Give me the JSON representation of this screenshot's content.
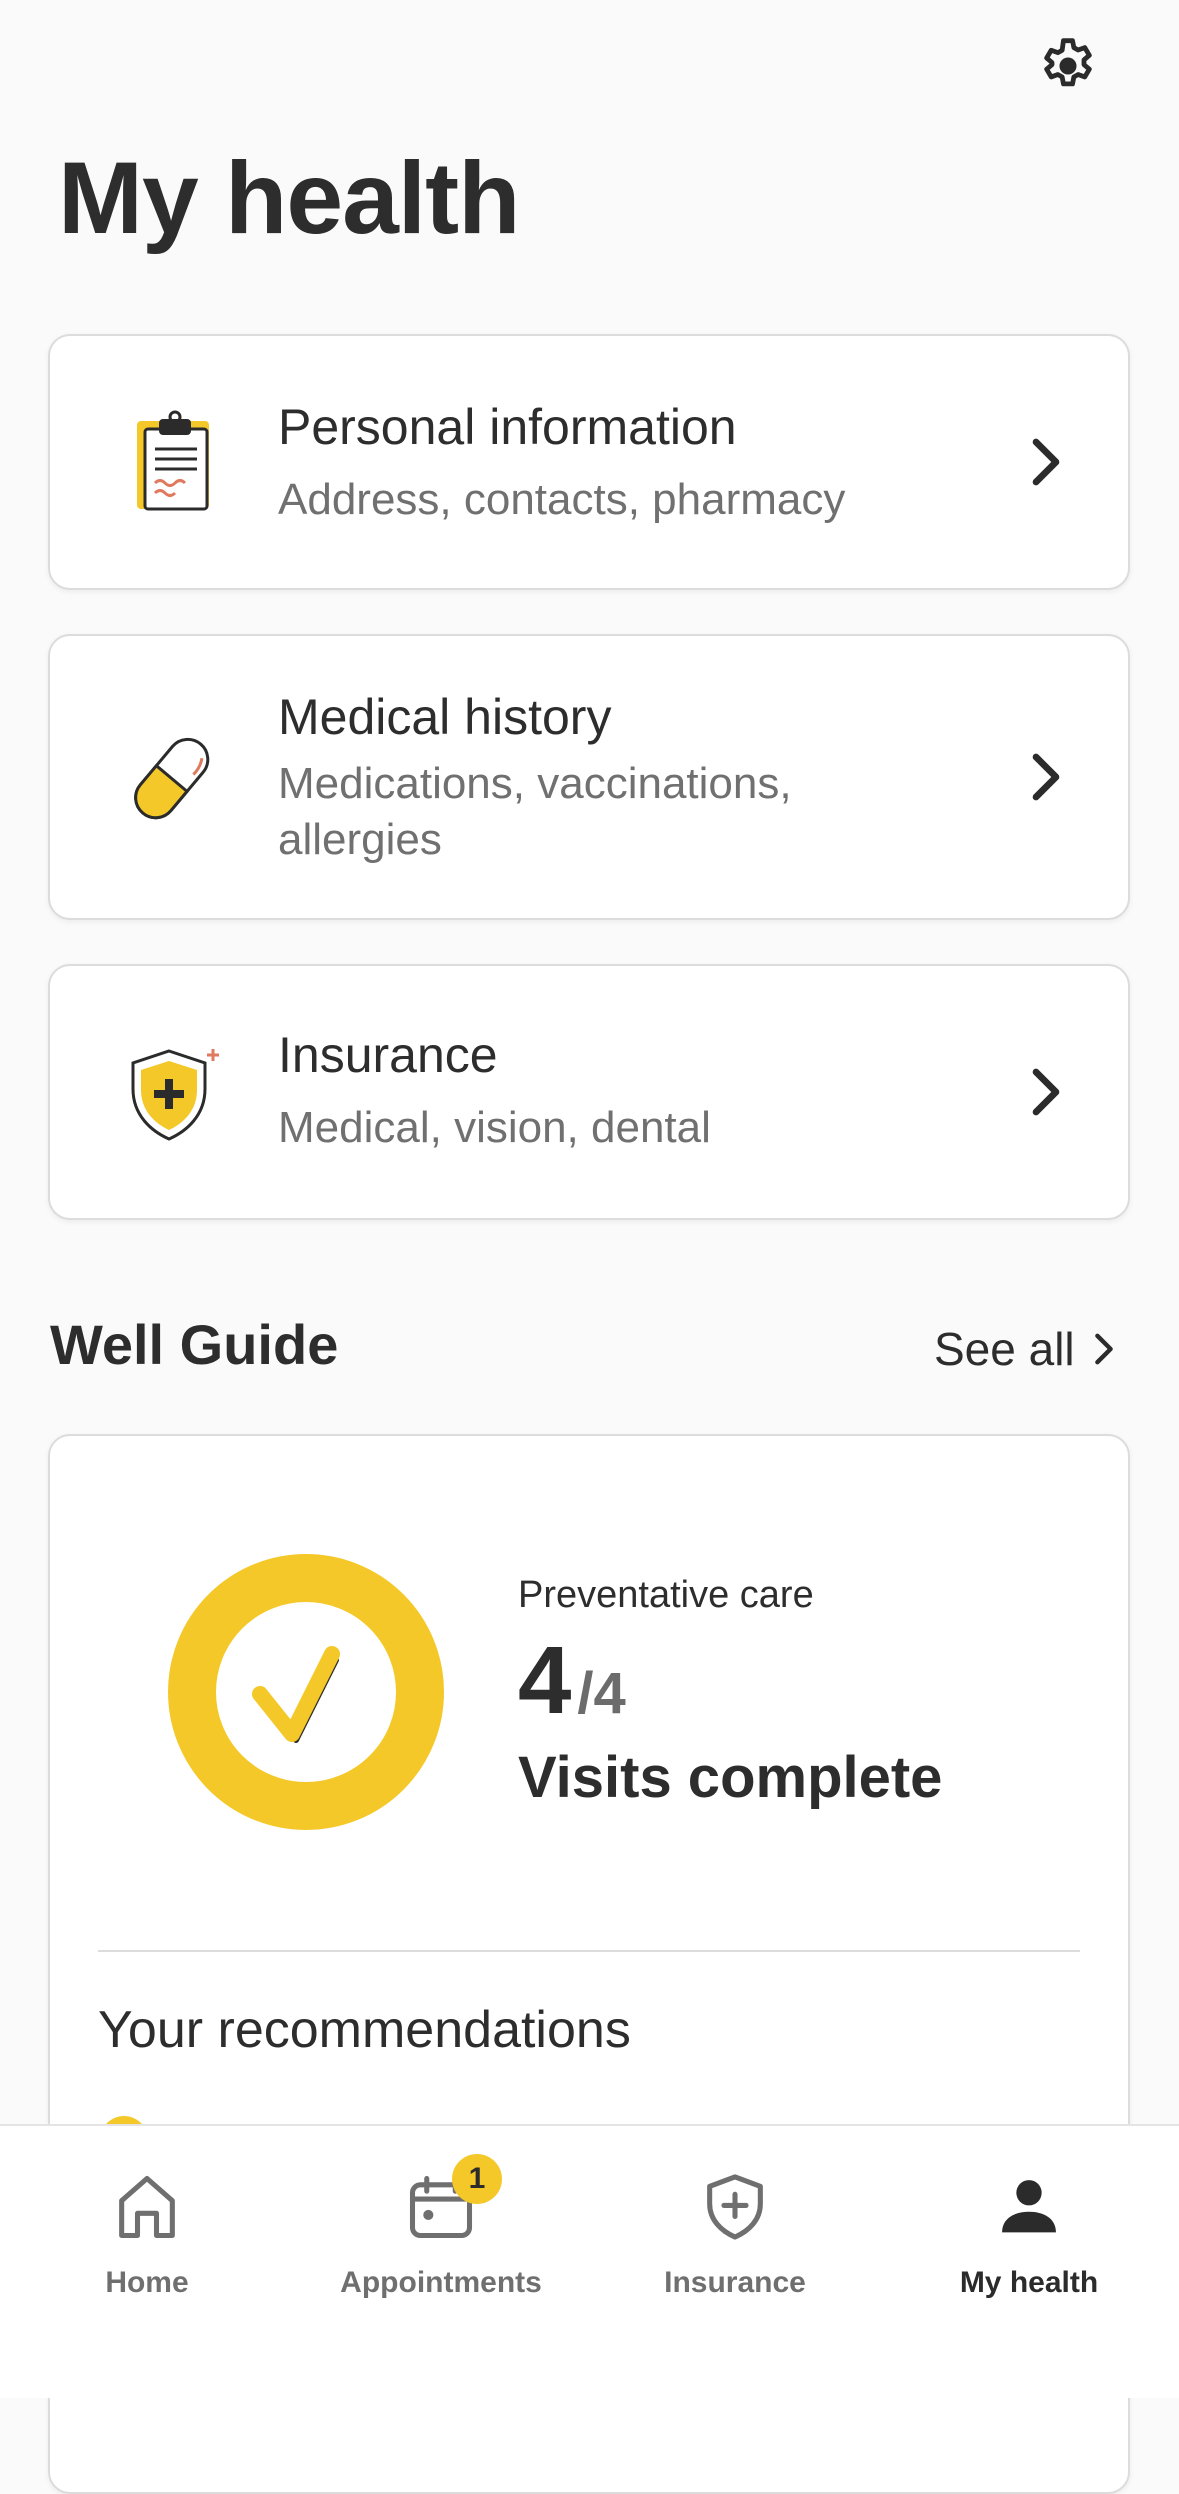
{
  "header": {
    "title": "My health",
    "settings_icon": "gear-icon"
  },
  "cards": [
    {
      "title": "Personal information",
      "subtitle": "Address, contacts, pharmacy",
      "icon": "clipboard-icon"
    },
    {
      "title": "Medical history",
      "subtitle": "Medications, vaccinations, allergies",
      "icon": "pill-icon"
    },
    {
      "title": "Insurance",
      "subtitle": "Medical, vision, dental",
      "icon": "shield-plus-icon"
    }
  ],
  "well_guide": {
    "title": "Well Guide",
    "see_all": "See all",
    "label": "Preventative care",
    "count": "4",
    "total": "/4",
    "status": "Visits complete",
    "progress": 1.0,
    "recommendations_title": "Your recommendations"
  },
  "bottom_nav": {
    "tabs": [
      {
        "label": "Home",
        "icon": "home-icon"
      },
      {
        "label": "Appointments",
        "icon": "calendar-icon",
        "badge": "1"
      },
      {
        "label": "Insurance",
        "icon": "shield-plus-icon"
      },
      {
        "label": "My health",
        "icon": "person-icon",
        "active": true
      }
    ]
  },
  "colors": {
    "accent": "#f5c829",
    "text": "#2d2d2d",
    "muted": "#707070"
  }
}
